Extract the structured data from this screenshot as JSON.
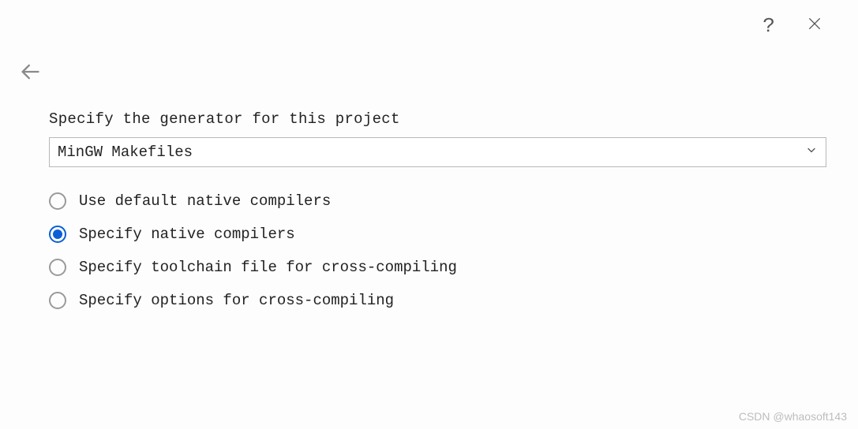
{
  "titlebar": {
    "help_label": "?",
    "close_label": "×"
  },
  "content": {
    "prompt": "Specify the generator for this project",
    "generator_value": "MinGW Makefiles"
  },
  "options": [
    {
      "label": "Use default native compilers",
      "selected": false
    },
    {
      "label": "Specify native compilers",
      "selected": true
    },
    {
      "label": "Specify toolchain file for cross-compiling",
      "selected": false
    },
    {
      "label": "Specify options for cross-compiling",
      "selected": false
    }
  ],
  "watermark": "CSDN @whaosoft143"
}
